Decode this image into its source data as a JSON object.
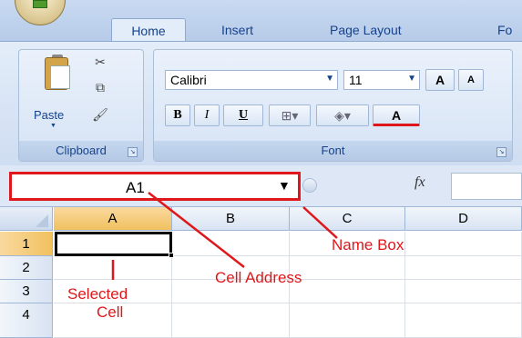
{
  "ribbon": {
    "tabs": [
      "Home",
      "Insert",
      "Page Layout",
      "Fo"
    ],
    "clipboard": {
      "paste_label": "Paste",
      "group_label": "Clipboard"
    },
    "font": {
      "font_name": "Calibri",
      "font_size": "11",
      "group_label": "Font",
      "bold": "B",
      "italic": "I",
      "underline": "U",
      "grow": "A",
      "shrink": "A",
      "color": "A"
    }
  },
  "formula_bar": {
    "name_box_value": "A1",
    "fx_label": "fx"
  },
  "grid": {
    "columns": [
      "A",
      "B",
      "C",
      "D"
    ],
    "rows": [
      "1",
      "2",
      "3",
      "4"
    ]
  },
  "annotations": {
    "name_box": "Name Box",
    "cell_address": "Cell Address",
    "selected_cell_line1": "Selected",
    "selected_cell_line2": "Cell"
  },
  "colors": {
    "annotation": "#e0171a",
    "active_header": "#f1c15f"
  }
}
